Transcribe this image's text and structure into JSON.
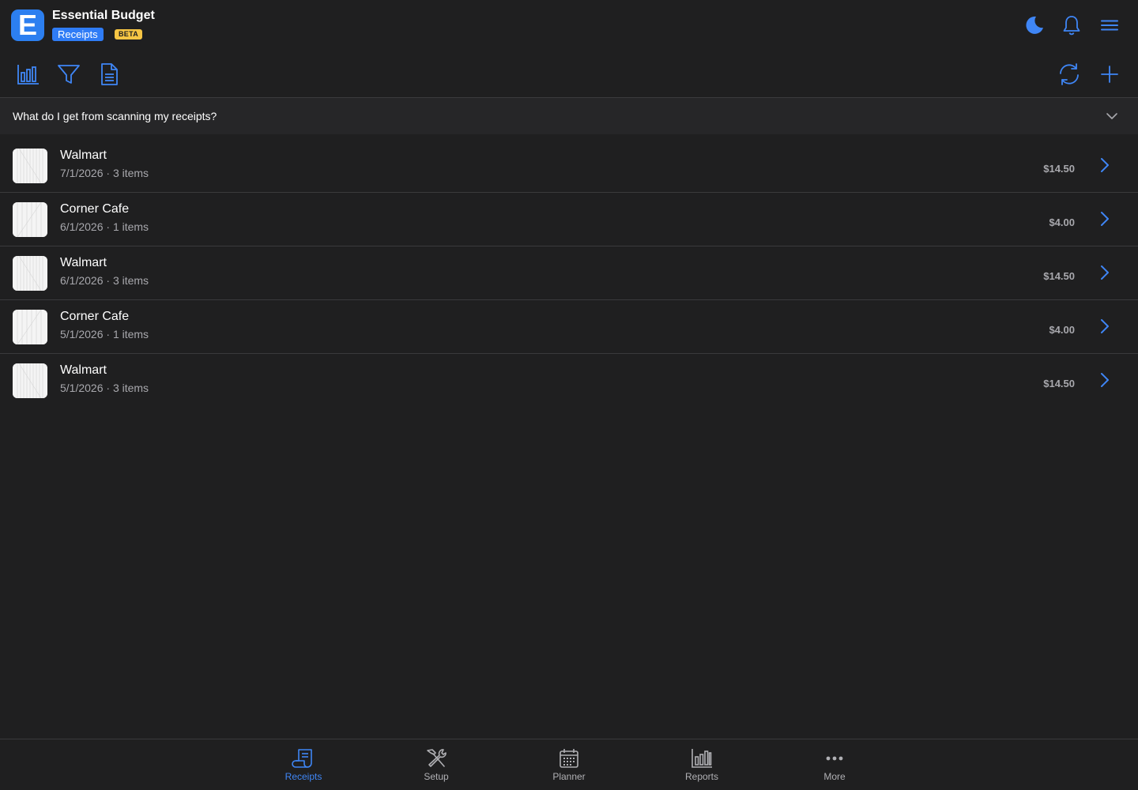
{
  "app": {
    "title": "Essential Budget",
    "section_label": "Receipts",
    "beta_label": "BETA",
    "logo_letter": "E"
  },
  "colors": {
    "accent": "#3f86f6",
    "background": "#1f1f20",
    "beta": "#f6c544",
    "muted_text": "#a8a8ad"
  },
  "header_icons": [
    "moon-icon",
    "bell-icon",
    "menu-icon"
  ],
  "toolbar_icons": [
    "bar-chart-icon",
    "filter-icon",
    "document-icon",
    "sync-icon",
    "plus-icon"
  ],
  "faq": {
    "question": "What do I get from scanning my receipts?",
    "expanded": false
  },
  "receipts": [
    {
      "merchant": "Walmart",
      "meta": "7/1/2026 · 3 items",
      "amount": "$14.50"
    },
    {
      "merchant": "Corner Cafe",
      "meta": "6/1/2026 · 1 items",
      "amount": "$4.00"
    },
    {
      "merchant": "Walmart",
      "meta": "6/1/2026 · 3 items",
      "amount": "$14.50"
    },
    {
      "merchant": "Corner Cafe",
      "meta": "5/1/2026 · 1 items",
      "amount": "$4.00"
    },
    {
      "merchant": "Walmart",
      "meta": "5/1/2026 · 3 items",
      "amount": "$14.50"
    }
  ],
  "tabs": [
    {
      "label": "Receipts",
      "icon": "receipt-icon",
      "active": true
    },
    {
      "label": "Setup",
      "icon": "tools-icon",
      "active": false
    },
    {
      "label": "Planner",
      "icon": "calendar-icon",
      "active": false
    },
    {
      "label": "Reports",
      "icon": "bar-chart-icon",
      "active": false
    },
    {
      "label": "More",
      "icon": "more-icon",
      "active": false
    }
  ]
}
